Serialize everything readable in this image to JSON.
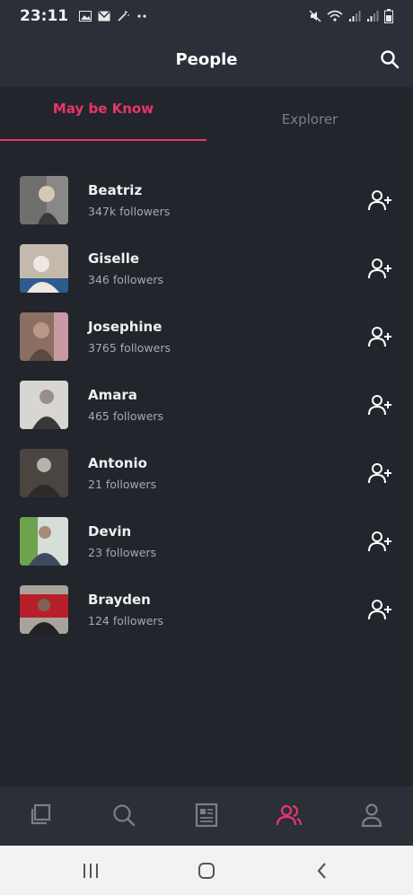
{
  "status_bar": {
    "time": "23:11",
    "left_icons": [
      "gallery-icon",
      "mail-icon",
      "wand-icon",
      "more-dots-icon"
    ],
    "right_icons": [
      "mute-icon",
      "wifi-icon",
      "signal-icon",
      "signal-icon",
      "battery-icon"
    ]
  },
  "header": {
    "title": "People",
    "search_icon": "search-icon"
  },
  "tabs": [
    {
      "label": "May be Know",
      "active": true
    },
    {
      "label": "Explorer",
      "active": false
    }
  ],
  "people": [
    {
      "name": "Beatriz",
      "followers": "347k followers",
      "colors": [
        "#6f6f6f",
        "#d6c8b6",
        "#3a3a3a"
      ]
    },
    {
      "name": "Giselle",
      "followers": "346 followers",
      "colors": [
        "#c3b9ad",
        "#ede8e1",
        "#2d5b8e"
      ]
    },
    {
      "name": "Josephine",
      "followers": "3765 followers",
      "colors": [
        "#8a6f62",
        "#b99884",
        "#c99aa3"
      ]
    },
    {
      "name": "Amara",
      "followers": "465 followers",
      "colors": [
        "#d8d6d2",
        "#3a3837",
        "#9a8f86"
      ]
    },
    {
      "name": "Antonio",
      "followers": "21 followers",
      "colors": [
        "#4a4541",
        "#b9b2aa",
        "#2e2b29"
      ]
    },
    {
      "name": "Devin",
      "followers": "23 followers",
      "colors": [
        "#6fa24f",
        "#3c4a5e",
        "#d7ddd8"
      ]
    },
    {
      "name": "Brayden",
      "followers": "124 followers",
      "colors": [
        "#b71f2a",
        "#222222",
        "#a9a39b"
      ]
    }
  ],
  "add_icon": "add-user-icon",
  "bottom_nav": [
    {
      "icon": "copy-icon",
      "active": false
    },
    {
      "icon": "search-icon",
      "active": false
    },
    {
      "icon": "news-icon",
      "active": true
    },
    {
      "icon": "people-icon",
      "active": true
    },
    {
      "icon": "profile-icon",
      "active": false
    }
  ],
  "system_nav": [
    "recents-icon",
    "home-icon",
    "back-icon"
  ],
  "colors": {
    "accent": "#e8356b",
    "background": "#22252c",
    "bar": "#2b2f37",
    "muted": "#7b7e84"
  }
}
